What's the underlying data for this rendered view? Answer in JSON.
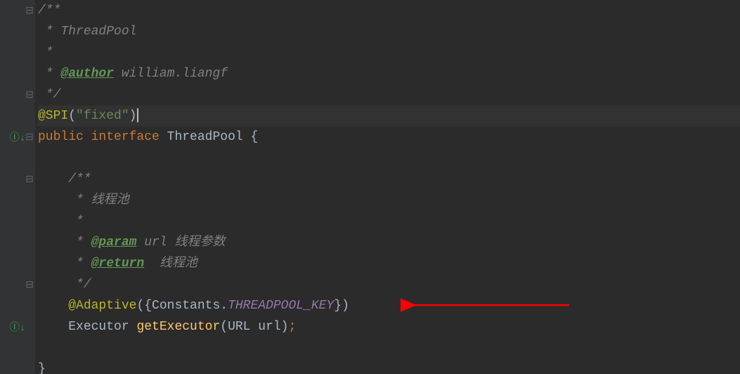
{
  "lines": {
    "l1": {
      "c1": "/**"
    },
    "l2": {
      "c1": " * ThreadPool"
    },
    "l3": {
      "c1": " *"
    },
    "l4": {
      "c1": " * ",
      "t1": "@author",
      "c2": " william.liangf"
    },
    "l5": {
      "c1": " */"
    },
    "l6": {
      "a1": "@SPI",
      "p1": "(",
      "s1": "\"fixed\"",
      "p2": ")"
    },
    "l7": {
      "k1": "public ",
      "k2": "interface ",
      "t1": "ThreadPool {"
    },
    "l8": {},
    "l9": {
      "c1": "    /**"
    },
    "l10": {
      "c1": "     * 线程池"
    },
    "l11": {
      "c1": "     *"
    },
    "l12": {
      "c1": "     * ",
      "t1": "@param",
      "c2": " url 线程参数"
    },
    "l13": {
      "c1": "     * ",
      "t1": "@return",
      "c2": "  线程池"
    },
    "l14": {
      "c1": "     */"
    },
    "l15": {
      "ind": "    ",
      "a1": "@Adaptive",
      "p1": "({Constants.",
      "sf": "THREADPOOL_KEY",
      "p2": "})"
    },
    "l16": {
      "ind": "    ",
      "t1": "Executor ",
      "m1": "getExecutor",
      "p1": "(URL url)",
      "sc": ";"
    },
    "l17": {},
    "l18": {
      "p1": "}"
    }
  },
  "gutter": {
    "impl1_title": "Has implementations",
    "impl2_title": "Has implementations"
  }
}
